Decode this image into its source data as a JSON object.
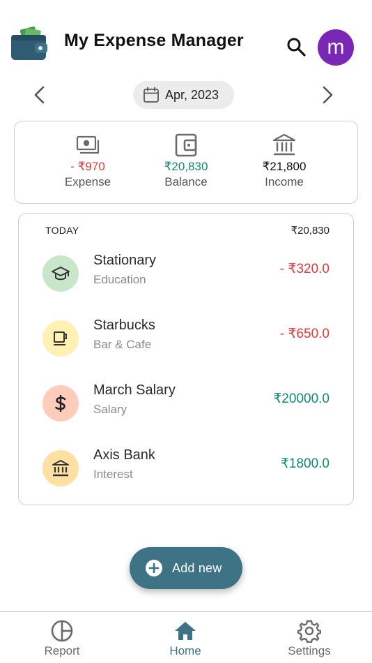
{
  "header": {
    "title": "My Expense Manager",
    "avatar_letter": "m",
    "logo_icon": "wallet-icon",
    "search_icon": "search-icon"
  },
  "month_selector": {
    "label": "Apr, 2023",
    "prev_icon": "chevron-left-icon",
    "next_icon": "chevron-right-icon",
    "calendar_icon": "calendar-icon"
  },
  "summary": {
    "expense": {
      "amount": "- ₹970",
      "label": "Expense",
      "icon": "cash-icon",
      "color": "#e53935"
    },
    "balance": {
      "amount": "₹20,830",
      "label": "Balance",
      "icon": "wallet-icon",
      "color": "#0e8a74"
    },
    "income": {
      "amount": "₹21,800",
      "label": "Income",
      "icon": "bank-icon",
      "color": "#111111"
    }
  },
  "transactions": {
    "day_label": "TODAY",
    "day_total": "₹20,830",
    "items": [
      {
        "title": "Stationary",
        "category": "Education",
        "amount": "- ₹320.0",
        "icon": "graduation-cap-icon",
        "icon_bg": "#c8e6c9",
        "type": "expense"
      },
      {
        "title": "Starbucks",
        "category": "Bar & Cafe",
        "amount": "- ₹650.0",
        "icon": "coffee-cup-icon",
        "icon_bg": "#fff0b3",
        "type": "expense"
      },
      {
        "title": "March Salary",
        "category": "Salary",
        "amount": "₹20000.0",
        "icon": "dollar-icon",
        "icon_bg": "#ffccbc",
        "type": "income"
      },
      {
        "title": "Axis Bank",
        "category": "Interest",
        "amount": "₹1800.0",
        "icon": "bank-icon",
        "icon_bg": "#ffe0a3",
        "type": "income"
      }
    ]
  },
  "fab": {
    "label": "Add new",
    "icon": "plus-circle-icon",
    "color": "#3e7385"
  },
  "bottom_nav": {
    "items": [
      {
        "label": "Report",
        "icon": "pie-chart-icon",
        "active": false
      },
      {
        "label": "Home",
        "icon": "home-icon",
        "active": true
      },
      {
        "label": "Settings",
        "icon": "gear-icon",
        "active": false
      }
    ]
  },
  "colors": {
    "accent": "#3e7385",
    "avatar": "#7b27b5",
    "expense": "#e53935",
    "income": "#0e8a74"
  }
}
